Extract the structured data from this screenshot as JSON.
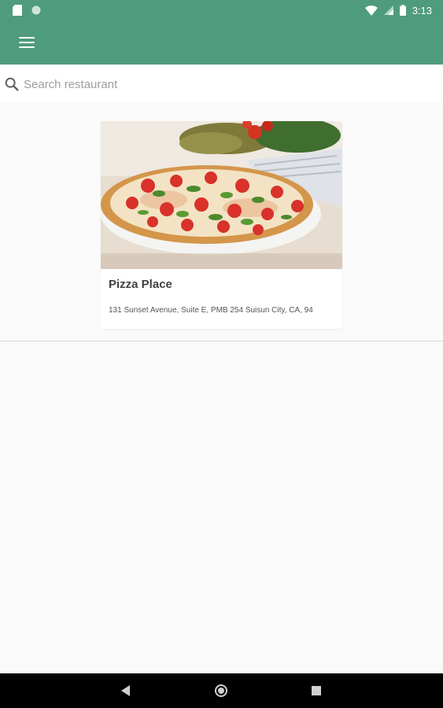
{
  "status_bar": {
    "time": "3:13",
    "icons": [
      "sd-card-icon",
      "circle-notification-icon",
      "wifi-icon",
      "signal-icon",
      "battery-icon"
    ]
  },
  "app_bar": {
    "menu_icon": "hamburger-menu-icon",
    "color": "#4f9b7d"
  },
  "search": {
    "placeholder": "Search restaurant",
    "value": ""
  },
  "restaurants": [
    {
      "name": "Pizza Place",
      "address": "131 Sunset Avenue, Suite E, PMB 254 Suisun City, CA, 94"
    }
  ],
  "nav_bar": {
    "icons": [
      "back-icon",
      "home-icon",
      "recents-icon"
    ]
  }
}
